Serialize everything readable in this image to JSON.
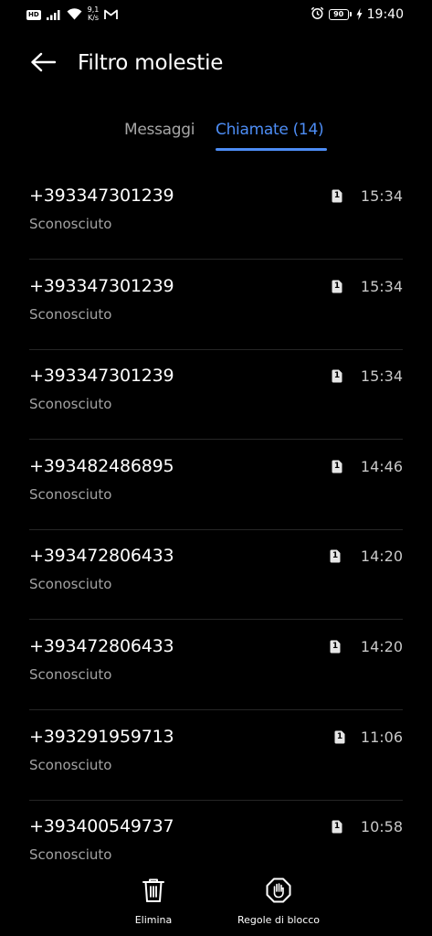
{
  "status_bar": {
    "hd_badge": "HD",
    "speed_value": "9,1",
    "speed_unit": "K/s",
    "battery_level": "90",
    "clock": "19:40"
  },
  "header": {
    "title": "Filtro molestie"
  },
  "tabs": [
    {
      "label": "Messaggi",
      "selected": false
    },
    {
      "label": "Chiamate (14)",
      "selected": true
    }
  ],
  "calls": [
    {
      "number": "+393347301239",
      "status": "Sconosciuto",
      "sim": "1",
      "time": "15:34"
    },
    {
      "number": "+393347301239",
      "status": "Sconosciuto",
      "sim": "1",
      "time": "15:34"
    },
    {
      "number": "+393347301239",
      "status": "Sconosciuto",
      "sim": "1",
      "time": "15:34"
    },
    {
      "number": "+393482486895",
      "status": "Sconosciuto",
      "sim": "1",
      "time": "14:46"
    },
    {
      "number": "+393472806433",
      "status": "Sconosciuto",
      "sim": "1",
      "time": "14:20"
    },
    {
      "number": "+393472806433",
      "status": "Sconosciuto",
      "sim": "1",
      "time": "14:20"
    },
    {
      "number": "+393291959713",
      "status": "Sconosciuto",
      "sim": "1",
      "time": "11:06"
    },
    {
      "number": "+393400549737",
      "status": "Sconosciuto",
      "sim": "1",
      "time": "10:58"
    }
  ],
  "bottom_bar": {
    "delete_label": "Elimina",
    "rules_label": "Regole di blocco"
  },
  "icons": {
    "back": "arrow-left-icon",
    "sim": "sim-card-icon",
    "delete": "trash-icon",
    "rules": "hand-stop-icon"
  },
  "colors": {
    "background": "#000000",
    "accent": "#4d8df5",
    "secondary_text": "#a3a3a3"
  }
}
